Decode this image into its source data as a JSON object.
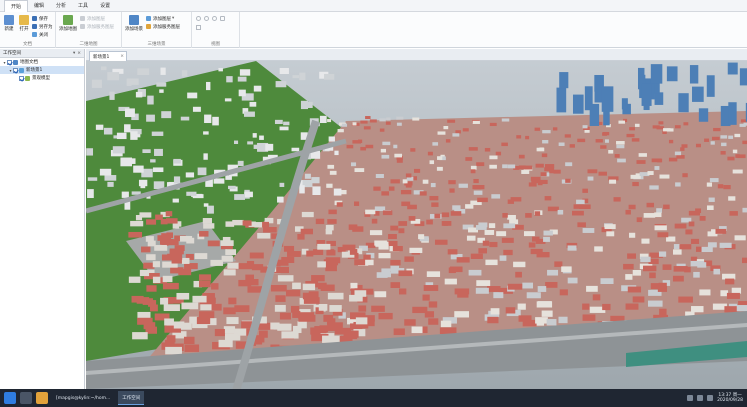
{
  "menu": {
    "tabs": [
      "开始",
      "编辑",
      "分析",
      "工具",
      "设置"
    ],
    "active": 0
  },
  "ribbon": {
    "document": {
      "new_label": "新建",
      "open_label": "打开",
      "save_label": "保存",
      "save_as_label": "另存为",
      "close_label": "关闭",
      "group_label": "文档"
    },
    "map2d": {
      "add_map_label": "添加地图",
      "add_layer_label": "添加图层",
      "add_service_label": "添加服务图层",
      "group_label": "二维地图"
    },
    "scene3d": {
      "add_scene_label": "添加场景",
      "add_layer_label": "添加图层",
      "add_service_label": "添加服务图层",
      "group_label": "三维场景"
    },
    "view": {
      "group_label": "视图"
    }
  },
  "panel": {
    "title": "工作空间",
    "tree": [
      {
        "label": "地图文档",
        "level": 0,
        "checked": true,
        "expanded": true
      },
      {
        "label": "新场景1",
        "level": 1,
        "checked": true,
        "expanded": true,
        "selected": true
      },
      {
        "label": "景观模型",
        "level": 2,
        "checked": true
      }
    ]
  },
  "view": {
    "tab_label": "新场景1",
    "close_glyph": "×"
  },
  "taskbar": {
    "apps": [
      {
        "label": "[mapgis@kylin:~/hom...",
        "active": false
      },
      {
        "label": "工作空间",
        "active": true
      }
    ],
    "time": "13:37 周一",
    "date": "2020/09/28"
  },
  "colors": {
    "ribbon_bg": "#fbfcfd",
    "panel_header": "#e9edf2",
    "selected_row": "#cfe1f6",
    "taskbar_bg": "#1f2632",
    "roof_red": "#c8665c",
    "grass": "#4e8a3c",
    "road": "#9ea3a6",
    "tower_blue": "#4d7fb6"
  }
}
